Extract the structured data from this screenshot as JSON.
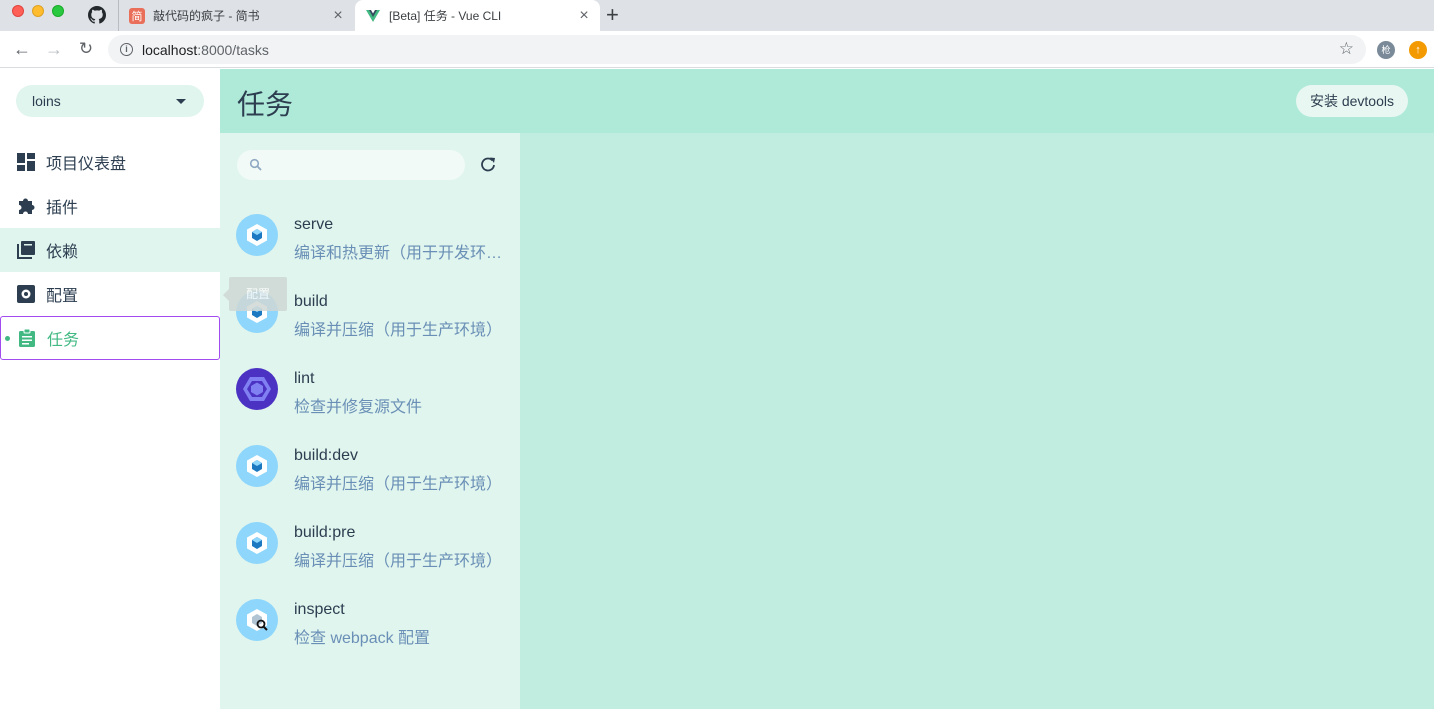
{
  "browser": {
    "tabs": [
      {
        "title": "敲代码的疯子 - 简书",
        "favicon": "jianshu-icon",
        "favicon_text": "简"
      },
      {
        "title": "[Beta] 任务 - Vue CLI",
        "favicon": "vue-icon"
      }
    ],
    "url_host": "localhost",
    "url_rest": ":8000/tasks",
    "ext_label": "枪"
  },
  "sidebar": {
    "project": "loins",
    "items": [
      {
        "label": "项目仪表盘",
        "icon": "dashboard-icon"
      },
      {
        "label": "插件",
        "icon": "puzzle-icon"
      },
      {
        "label": "依赖",
        "icon": "library-icon"
      },
      {
        "label": "配置",
        "icon": "settings-icon"
      },
      {
        "label": "任务",
        "icon": "clipboard-icon"
      }
    ]
  },
  "tooltip": "配置",
  "header": {
    "title": "任务",
    "devtools_button": "安装 devtools"
  },
  "tasks": [
    {
      "name": "serve",
      "desc": "编译和热更新（用于开发环境）",
      "icon": "webpack-icon"
    },
    {
      "name": "build",
      "desc": "编译并压缩（用于生产环境）",
      "icon": "webpack-icon"
    },
    {
      "name": "lint",
      "desc": "检查并修复源文件",
      "icon": "eslint-icon"
    },
    {
      "name": "build:dev",
      "desc": "编译并压缩（用于生产环境）",
      "icon": "webpack-icon"
    },
    {
      "name": "build:pre",
      "desc": "编译并压缩（用于生产环境）",
      "icon": "webpack-icon"
    },
    {
      "name": "inspect",
      "desc": "检查 webpack 配置",
      "icon": "inspect-icon"
    }
  ],
  "colors": {
    "accent": "#42b983",
    "header_bg": "#afead9",
    "panel_bg": "#e0f5ee",
    "content_bg": "#c1ede0",
    "active_border": "#a14bf0"
  }
}
